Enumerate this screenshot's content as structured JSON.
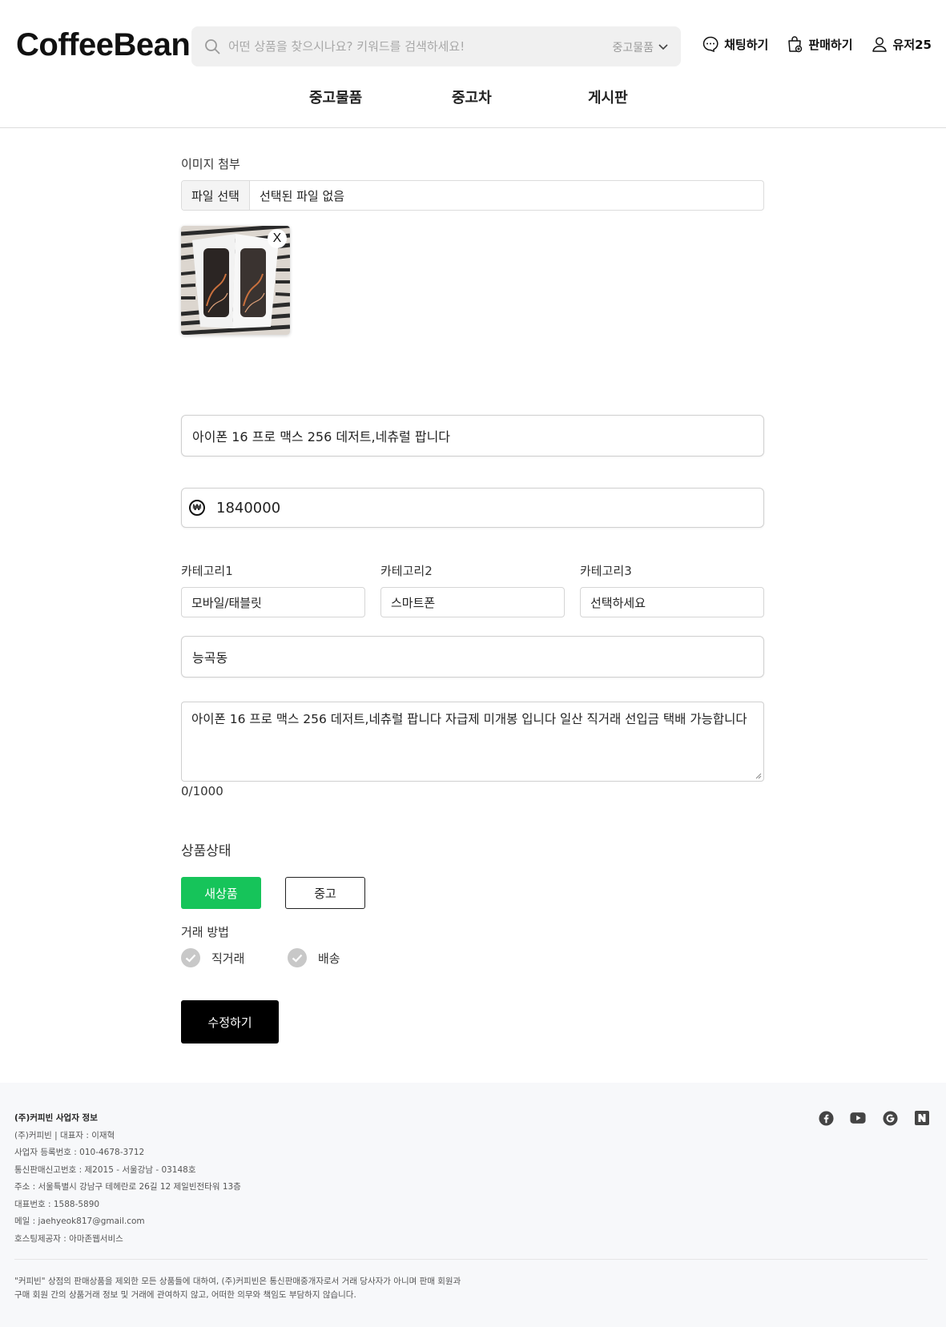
{
  "header": {
    "logo": "CoffeeBean",
    "search_placeholder": "어떤 상품을 찾으시나요? 키워드를 검색하세요!",
    "search_scope": "중고물품",
    "actions": [
      {
        "label": "채팅하기",
        "icon": "chat-icon"
      },
      {
        "label": "판매하기",
        "icon": "shopping-bag-icon"
      },
      {
        "label": "유저25",
        "icon": "user-icon"
      }
    ],
    "menu": [
      "중고물품",
      "중고차",
      "게시판"
    ]
  },
  "form": {
    "image_label": "이미지 첨부",
    "file_button": "파일 선택",
    "file_status": "선택된 파일 없음",
    "thumbnail_remove": "X",
    "title_value": "아이폰 16 프로 맥스 256 데저트,네츄럴 팝니다",
    "price_value": "1840000",
    "currency_symbol": "₩",
    "categories": [
      {
        "label": "카테고리1",
        "value": "모바일/태블릿"
      },
      {
        "label": "카테고리2",
        "value": "스마트폰"
      },
      {
        "label": "카테고리3",
        "value": "선택하세요"
      }
    ],
    "location_value": "능곡동",
    "description_value": "아이폰 16 프로 맥스 256 데저트,네츄럴 팝니다 자급제 미개봉 입니다 일산 직거래 선입금 택배 가능합니다",
    "char_counter": "0/1000",
    "condition_label": "상품상태",
    "condition_new": "새상품",
    "condition_used": "중고",
    "trade_label": "거래 방법",
    "trade_direct": "직거래",
    "trade_delivery": "배송",
    "submit_label": "수정하기"
  },
  "footer": {
    "title": "(주)커피빈 사업자 정보",
    "lines": [
      "(주)커피빈 | 대표자 : 이재혁",
      "사업자 등록번호 : 010-4678-3712",
      "통신판매신고번호 : 제2015 - 서울강남 - 03148호",
      "주소 : 서울특별시 강남구 테헤란로 26길 12 제일빈전타워 13층",
      "대표번호 : 1588-5890",
      "메일 : jaehyeok817@gmail.com",
      "호스팅제공자 : 아마존웹서비스"
    ],
    "notice_1": "\"커피빈\" 상점의 판매상품을 제외한 모든 상품들에 대하여, (주)커피빈은 통신판매중개자로서 거래 당사자가 아니며 판매 회원과",
    "notice_2": "구매 회원 간의 상품거래 정보 및 거래에 관여하지 않고, 어떠한 의무와 책임도 부담하지 않습니다.",
    "socials": [
      "facebook-icon",
      "youtube-icon",
      "google-play-icon",
      "naver-icon"
    ]
  },
  "colors": {
    "accent_green": "#16c45a",
    "submit_black": "#000000",
    "search_bg": "#f0f0f0",
    "footer_bg": "#f7f8fa"
  }
}
